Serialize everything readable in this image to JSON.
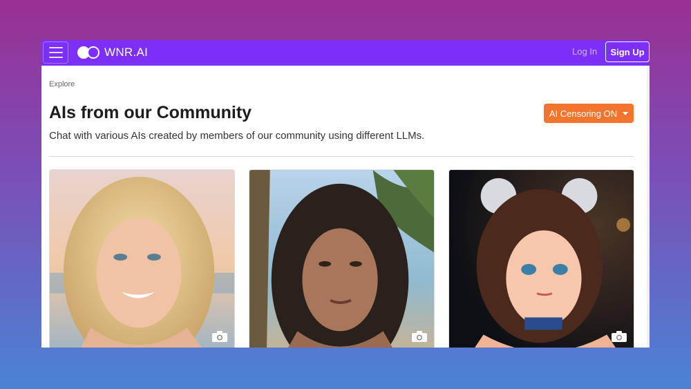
{
  "nav": {
    "brand": "WNR.AI",
    "login_label": "Log In",
    "signup_label": "Sign Up"
  },
  "breadcrumb": "Explore",
  "header": {
    "title": "AIs from our Community",
    "subtitle": "Chat with various AIs created by members of our community using different LLMs.",
    "censor_button": "AI Censoring ON"
  },
  "colors": {
    "nav_bg": "#7b2ff7",
    "censor_btn": "#f2742d"
  },
  "cards": [
    {
      "icon": "camera-icon"
    },
    {
      "icon": "camera-icon"
    },
    {
      "icon": "camera-icon"
    }
  ]
}
